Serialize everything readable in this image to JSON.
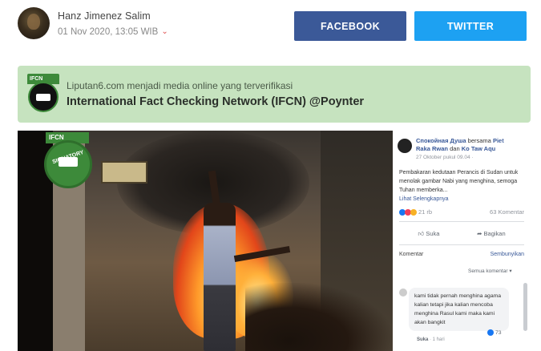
{
  "author": {
    "name": "Hanz Jimenez Salim",
    "date": "01 Nov 2020, 13:05 WIB"
  },
  "share": {
    "facebook_label": "FACEBOOK",
    "twitter_label": "TWITTER"
  },
  "banner": {
    "badge_label": "IFCN",
    "subtitle": "Liputan6.com menjadi media online yang terverifikasi",
    "title": "International Fact Checking Network (IFCN) @Poynter"
  },
  "video": {
    "watermark_top": "IFCN",
    "watermark_text": "SIGNATORY",
    "fb_post": {
      "author": "Спокойная Душа",
      "with_word": "bersama",
      "tagged_1": "Piet Raka Rwan",
      "and_word": "dan",
      "tagged_2": "Ko Taw Aqu",
      "time": "27 Oktober pukul 09.04 · ",
      "text": "Pembakaran kedutaan Perancis di Sudan untuk menolak gambar Nabi yang menghina, semoga Tuhan memberka...",
      "see_more": "Lihat Selengkapnya",
      "reactions": "21 rb",
      "comments": "63 Komentar",
      "like": "Suka",
      "share": "Bagikan",
      "comment_heading": "Komentar",
      "hide": "Sembunyikan",
      "all_comments": "Semua komentar",
      "comment_text": "kami tidak pernah menghina agama kalian tetapi jika kalian mencoba menghina Rasul kami maka kami akan bangkit",
      "comment_reactions": "73",
      "reply_like": "Suka",
      "reply_time": "· 1 hari"
    }
  }
}
